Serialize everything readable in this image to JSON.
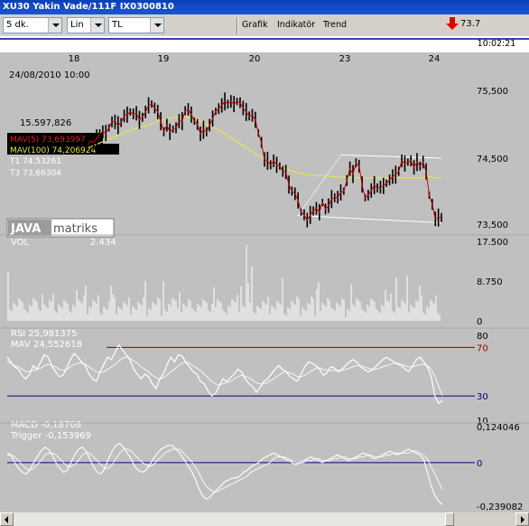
{
  "window": {
    "title": "XU30 Yakin Vade/111F  IX0300810"
  },
  "toolbar": {
    "period": "5 dk.",
    "scale": "Lin",
    "currency": "TL",
    "menu": [
      "Grafik",
      "Indikatör",
      "Trend"
    ],
    "last_value": "73.7",
    "time": "10:02:21"
  },
  "colors": {
    "background": "#c0c0c0",
    "price": "#000000",
    "mav5": "#cc0000",
    "mav100": "#e6e64d",
    "line": "#ffffff",
    "reference": "#00008b",
    "rsi_70": "#8b0000",
    "title_bar": "#0a3fb8"
  },
  "icons": {
    "last_direction": "red-down-arrow-icon",
    "logo": "javamatriks-logo"
  },
  "chart_data": {
    "type": "line",
    "x_ticks": [
      "18",
      "19",
      "20",
      "23",
      "24"
    ],
    "panels": [
      {
        "name": "price",
        "cursor_label": "24/08/2010 10:00",
        "value_label": "15.597,826",
        "y_ticks": [
          "75,500",
          "74,500",
          "73,500"
        ],
        "y_tick_values": [
          75500,
          74500,
          73500
        ],
        "ylim": [
          73270,
          75800
        ],
        "legend": [
          "MAV(5) 73,693997",
          "MAV(100) 74,206924",
          "T1 74,53261",
          "T3 73,66304"
        ],
        "series": [
          {
            "values": [
              74700,
              74760,
              74740,
              74800,
              74870,
              74900,
              74880,
              74960,
              75050,
              75050,
              75000,
              75040,
              75140,
              75160,
              75200,
              75170,
              75180,
              75080,
              75120,
              75200,
              75300,
              75320,
              75260,
              75200,
              75060,
              74900,
              75000,
              74900,
              74940,
              74960,
              75060,
              75060,
              75220,
              75240,
              75160,
              75060,
              75010,
              74870,
              74930,
              74900,
              75000,
              75100,
              75210,
              75250,
              75300,
              75360,
              75320,
              75360,
              75320,
              75360,
              75340,
              75260,
              75200,
              75140,
              75150,
              75080,
              74880,
              74740,
              74480,
              74460,
              74400,
              74460,
              74400,
              74380,
              74300,
              74290,
              74100,
              74000,
              73960,
              73860,
              73680,
              73640,
              73560,
              73640,
              73700,
              73740,
              73680,
              73830,
              73730,
              73780,
              73880,
              73900,
              73910,
              73980,
              74000,
              74160,
              74340,
              74260,
              74430,
              74380,
              74100,
              73900,
              73940,
              74010,
              74090,
              74050,
              74060,
              74080,
              74120,
              74170,
              74220,
              74250,
              74300,
              74460,
              74420,
              74440,
              74460,
              74360,
              74440,
              74380,
              74440,
              74300,
              73940,
              73800,
              73580,
              73600,
              73600
            ]
          },
          {
            "values": [
              74660,
              74670,
              74690,
              74710,
              74730,
              74750,
              74770,
              74790,
              74810,
              74830,
              74850,
              74870,
              74890,
              74910,
              74925,
              74940,
              74955,
              74970,
              74980,
              74990,
              75000,
              75020,
              75040,
              75060,
              75070,
              75080,
              75090,
              75100,
              75110,
              75120,
              75125,
              75130,
              75130,
              75120,
              75100,
              75090,
              75080,
              75060,
              75040,
              75020,
              75000,
              74980,
              74950,
              74930,
              74900,
              74870,
              74840,
              74810,
              74780,
              74750,
              74720,
              74690,
              74660,
              74630,
              74600,
              74570,
              74540,
              74510,
              74480,
              74460,
              74440,
              74420,
              74400,
              74380,
              74360,
              74340,
              74320,
              74300,
              74290,
              74280,
              74270,
              74260,
              74250,
              74245,
              74240,
              74235,
              74230,
              74230,
              74230,
              74230,
              74220,
              74220,
              74215,
              74215,
              74210,
              74210,
              74210,
              74210,
              74205,
              74205,
              74200,
              74200,
              74200,
              74200,
              74200,
              74200,
              74200,
              74200,
              74200,
              74200,
              74200,
              74200,
              74200,
              74200,
              74200,
              74200,
              74200,
              74200,
              74200,
              74200,
              74210,
              74220,
              74220,
              74210,
              74200,
              74200,
              74200
            ]
          }
        ],
        "trend_channel": {
          "upper": [
            [
              73770,
              74550
            ],
            [
              74450,
              74500
            ]
          ],
          "lower": [
            [
              73560,
              73630
            ],
            [
              73620,
              73520
            ]
          ]
        }
      },
      {
        "name": "VOL",
        "label": "VOL",
        "value_label": "2.434",
        "y_ticks": [
          "17.500",
          "8.750",
          "0"
        ],
        "y_tick_values": [
          17500,
          8750,
          0
        ],
        "ylim": [
          0,
          17500
        ]
      },
      {
        "name": "RSI",
        "label": "RSI 25,981375",
        "label2": "MAV 24,552618",
        "y_ticks": [
          "80",
          "70",
          "30",
          "10"
        ],
        "y_tick_values": [
          80,
          70,
          30,
          10
        ],
        "ylim": [
          10,
          80
        ],
        "reference_lines": [
          70,
          30
        ],
        "series": [
          {
            "values": [
              62,
              58,
              54,
              52,
              47,
              44,
              48,
              55,
              52,
              58,
              64,
              62,
              55,
              50,
              46,
              47,
              53,
              60,
              65,
              62,
              58,
              55,
              48,
              44,
              42,
              50,
              56,
              62,
              60,
              66,
              72,
              68,
              64,
              60,
              52,
              48,
              44,
              48,
              46,
              40,
              36,
              44,
              48,
              56,
              62,
              58,
              64,
              63,
              58,
              54,
              50,
              48,
              42,
              40,
              34,
              30,
              32,
              38,
              44,
              42,
              45,
              48,
              52,
              50,
              44,
              40,
              38,
              33,
              37,
              42,
              44,
              48,
              52,
              55,
              52,
              50,
              46,
              44,
              42,
              48,
              54,
              58,
              57,
              55,
              52,
              47,
              49,
              54,
              53,
              50,
              52,
              55,
              58,
              60,
              58,
              54,
              52,
              50,
              51,
              54,
              57,
              60,
              62,
              60,
              58,
              56,
              55,
              52,
              50,
              55,
              60,
              62,
              58,
              54,
              46,
              30,
              24,
              26
            ]
          },
          {
            "values": [
              59,
              57,
              55,
              54,
              52,
              50,
              50,
              51,
              52,
              53,
              55,
              56,
              55,
              54,
              52,
              51,
              52,
              54,
              56,
              57,
              57,
              56,
              54,
              52,
              50,
              49,
              50,
              52,
              54,
              56,
              59,
              61,
              62,
              61,
              59,
              57,
              54,
              52,
              50,
              47,
              45,
              44,
              45,
              47,
              50,
              52,
              55,
              57,
              58,
              57,
              55,
              53,
              51,
              48,
              45,
              42,
              40,
              39,
              40,
              41,
              42,
              44,
              46,
              47,
              46,
              45,
              43,
              41,
              40,
              40,
              41,
              43,
              45,
              47,
              49,
              50,
              49,
              48,
              46,
              46,
              47,
              49,
              51,
              53,
              53,
              52,
              51,
              51,
              51,
              51,
              51,
              52,
              53,
              54,
              55,
              55,
              54,
              53,
              52,
              52,
              53,
              54,
              55,
              56,
              57,
              57,
              56,
              55,
              54,
              54,
              55,
              56,
              56,
              55,
              52,
              46,
              38,
              30
            ]
          }
        ]
      },
      {
        "name": "MACD",
        "label": "MACD -0,18708",
        "label2": "Trigger -0,153969",
        "y_ticks": [
          "0,124046",
          "0",
          "-0,239082"
        ],
        "y_tick_values": [
          0.124046,
          0,
          -0.239082
        ],
        "ylim": [
          -0.25,
          0.15
        ],
        "reference_lines": [
          0
        ],
        "series": [
          {
            "values": [
              0.05,
              0.04,
              0.0,
              -0.03,
              -0.05,
              -0.06,
              -0.04,
              0.0,
              0.03,
              0.06,
              0.08,
              0.07,
              0.04,
              0.0,
              -0.03,
              -0.05,
              -0.04,
              0.0,
              0.04,
              0.07,
              0.08,
              0.06,
              0.02,
              -0.02,
              -0.05,
              -0.06,
              -0.03,
              0.02,
              0.06,
              0.09,
              0.1,
              0.08,
              0.05,
              0.02,
              -0.02,
              -0.04,
              -0.05,
              -0.04,
              -0.01,
              0.02,
              0.05,
              0.07,
              0.08,
              0.09,
              0.09,
              0.07,
              0.05,
              0.02,
              -0.01,
              -0.04,
              -0.08,
              -0.13,
              -0.17,
              -0.19,
              -0.18,
              -0.16,
              -0.14,
              -0.12,
              -0.1,
              -0.09,
              -0.08,
              -0.08,
              -0.07,
              -0.05,
              -0.04,
              -0.02,
              -0.01,
              0.0,
              0.02,
              0.03,
              0.04,
              0.05,
              0.04,
              0.03,
              0.02,
              0.01,
              0.0,
              -0.01,
              0.0,
              0.01,
              0.02,
              0.03,
              0.02,
              0.01,
              0.0,
              0.01,
              0.02,
              0.03,
              0.04,
              0.03,
              0.02,
              0.01,
              0.02,
              0.03,
              0.04,
              0.05,
              0.04,
              0.03,
              0.02,
              0.03,
              0.04,
              0.05,
              0.06,
              0.05,
              0.04,
              0.05,
              0.06,
              0.07,
              0.06,
              0.05,
              0.04,
              0.02,
              -0.05,
              -0.12,
              -0.17,
              -0.2,
              -0.22
            ]
          },
          {
            "values": [
              0.04,
              0.04,
              0.03,
              0.01,
              -0.01,
              -0.03,
              -0.04,
              -0.03,
              -0.01,
              0.01,
              0.04,
              0.05,
              0.05,
              0.04,
              0.02,
              0.0,
              -0.02,
              -0.02,
              -0.01,
              0.01,
              0.04,
              0.05,
              0.05,
              0.03,
              0.01,
              -0.01,
              -0.03,
              -0.03,
              -0.01,
              0.02,
              0.05,
              0.07,
              0.07,
              0.06,
              0.04,
              0.02,
              0.0,
              -0.01,
              -0.02,
              -0.01,
              0.01,
              0.03,
              0.05,
              0.06,
              0.07,
              0.07,
              0.07,
              0.05,
              0.03,
              0.01,
              -0.02,
              -0.05,
              -0.09,
              -0.12,
              -0.14,
              -0.15,
              -0.15,
              -0.14,
              -0.13,
              -0.12,
              -0.11,
              -0.1,
              -0.09,
              -0.08,
              -0.07,
              -0.05,
              -0.04,
              -0.03,
              -0.02,
              -0.01,
              0.0,
              0.02,
              0.03,
              0.03,
              0.03,
              0.02,
              0.01,
              0.0,
              0.0,
              0.0,
              0.01,
              0.01,
              0.02,
              0.02,
              0.01,
              0.01,
              0.01,
              0.02,
              0.02,
              0.03,
              0.03,
              0.02,
              0.02,
              0.02,
              0.03,
              0.03,
              0.04,
              0.04,
              0.03,
              0.03,
              0.03,
              0.04,
              0.04,
              0.05,
              0.05,
              0.05,
              0.05,
              0.05,
              0.06,
              0.06,
              0.05,
              0.04,
              0.02,
              -0.02,
              -0.06,
              -0.1,
              -0.14
            ]
          }
        ]
      }
    ]
  }
}
